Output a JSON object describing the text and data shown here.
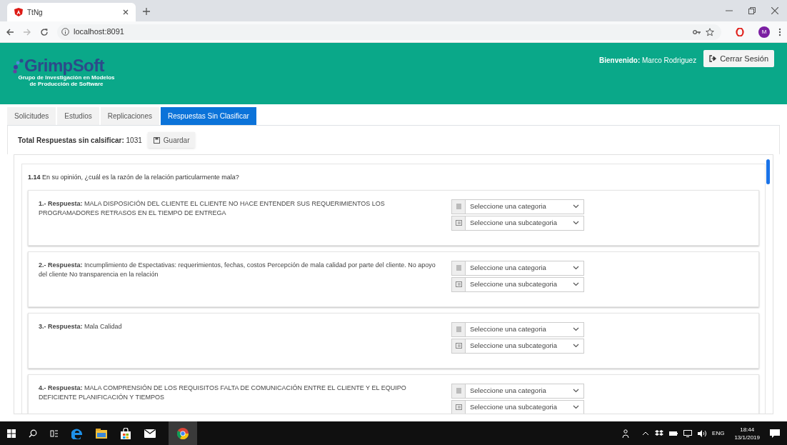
{
  "browser": {
    "tab_title": "TtNg",
    "url": "localhost:8091",
    "avatar": "M"
  },
  "header": {
    "logo": "GrimpSoft",
    "logo_subtitle": [
      "Grupo de Investigación en Modelos",
      "de Producción de Software"
    ],
    "welcome": "**Bienvenido:** Marco Rodriguez",
    "logout_button": "Cerrar Sesión"
  },
  "tabs": [
    {
      "label": "Solicitudes",
      "selected": false
    },
    {
      "label": "Estudios",
      "selected": false
    },
    {
      "label": "Replicaciones",
      "selected": false
    },
    {
      "label": "Respuestas Sin Clasificar",
      "selected": true
    }
  ],
  "toolbar": {
    "total": "**Total Respuestas sin calsificar:** 1031",
    "save_button": "Guardar"
  },
  "question": "**1.14** En su opinión, ¿cuál es la razón de la relación particularmente mala?",
  "answers": [
    {
      "text": "**1.- Respuesta:** MALA DISPOSICIÓN DEL CLIENTE  EL CLIENTE NO HACE ENTENDER SUS REQUERIMIENTOS  LOS PROGRAMADORES RETRASOS EN EL TIEMPO DE ENTREGA",
      "category": "Seleccione una categoria",
      "subcategory": "Seleccione una subcategoria"
    },
    {
      "text": "**2.- Respuesta:** Incumplimiento de Espectativas: requerimientos, fechas, costos Percepción de mala calidad por parte del cliente. No apoyo del cliente No transparencia en la relación",
      "category": "Seleccione una categoria",
      "subcategory": "Seleccione una subcategoria"
    },
    {
      "text": "**3.- Respuesta:** Mala Calidad",
      "category": "Seleccione una categoria",
      "subcategory": "Seleccione una subcategoria"
    },
    {
      "text": "**4.- Respuesta:** MALA COMPRENSIÓN DE LOS REQUISITOS FALTA DE COMUNICACIÓN ENTRE EL CLIENTE Y EL EQUIPO DEFICIENTE PLANIFICACIÓN Y TIEMPOS",
      "category": "Seleccione una categoria",
      "subcategory": "Seleccione una subcategoria"
    }
  ],
  "taskbar": {
    "language": "ENG",
    "time": "18:44",
    "date": "13/1/2019"
  }
}
